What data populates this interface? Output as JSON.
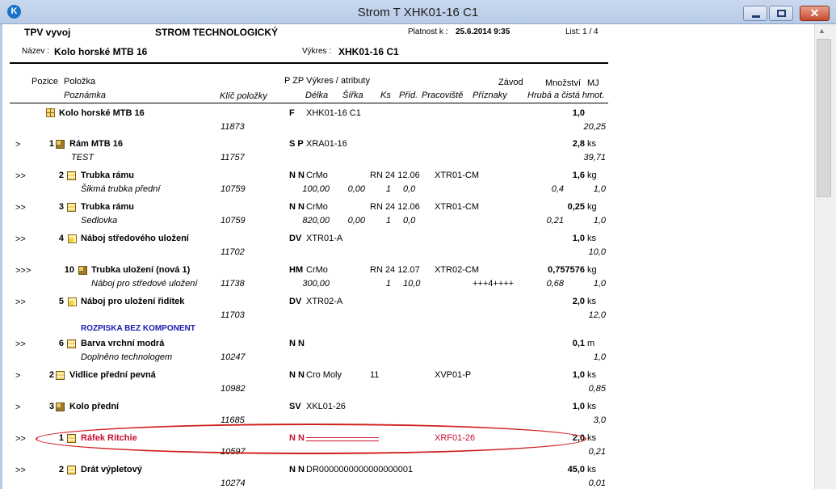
{
  "window": {
    "title": "Strom T  XHK01-16 C1"
  },
  "header": {
    "app": "TPV vyvoj",
    "report_title": "STROM TECHNOLOGICKÝ",
    "valid_label": "Platnost k :",
    "valid_value": "25.6.2014 9:35",
    "sheet": "List: 1 / 4",
    "name_label": "Název :",
    "name_value": "Kolo horské MTB 16",
    "drawing_label": "Výkres :",
    "drawing_value": "XHK01-16 C1"
  },
  "columns": {
    "pozice": "Pozice",
    "polozka": "Položka",
    "poznamka": "Poznámka",
    "klic": "Klíč položky",
    "pzp": "P ZP Výkres / atributy",
    "delka": "Délka",
    "sirka": "Šířka",
    "ks": "Ks",
    "prid": "Příd.",
    "pracoviste": "Pracoviště",
    "zavod": "Závod",
    "priznaky": "Příznaky",
    "mnozstvi": "Množství",
    "mj": "MJ",
    "hruba": "Hrubá a čistá hmot."
  },
  "rows": [
    {
      "level": "",
      "pos": "",
      "name": "Kolo horské MTB 16",
      "key": "11873",
      "pzp": "F",
      "drawing": "XHK01-16 C1",
      "qty": "1,0",
      "unit": "",
      "weight": "20,25"
    },
    {
      "level": ">",
      "pos": "1",
      "name": "Rám MTB 16",
      "note": "TEST",
      "key": "11757",
      "pzp": "S P",
      "drawing": "XRA01-16",
      "qty": "2,8",
      "unit": "ks",
      "weight": "39,71"
    },
    {
      "level": ">>",
      "pos": "2",
      "name": "Trubka rámu",
      "note": "Šikmá trubka přední",
      "key": "10759",
      "pzp": "N N",
      "drawing": "CrMo",
      "delka": "100,00",
      "sirka": "0,00",
      "ks": "1",
      "prid": "0,0",
      "rn": "RN 24 12.06",
      "prac": "XTR01-CM",
      "qty": "1,6",
      "unit": "kg",
      "gross": "0,4",
      "weight": "1,0"
    },
    {
      "level": ">>",
      "pos": "3",
      "name": "Trubka rámu",
      "note": "Sedlovka",
      "key": "10759",
      "pzp": "N N",
      "drawing": "CrMo",
      "delka": "820,00",
      "sirka": "0,00",
      "ks": "1",
      "prid": "0,0",
      "rn": "RN 24 12.06",
      "prac": "XTR01-CM",
      "qty": "0,25",
      "unit": "kg",
      "gross": "0,21",
      "weight": "1,0"
    },
    {
      "level": ">>",
      "pos": "4",
      "name": "Náboj středového uložení",
      "key": "11702",
      "pzp": "DV",
      "drawing": "XTR01-A",
      "qty": "1,0",
      "unit": "ks",
      "weight": "10,0"
    },
    {
      "level": ">>>",
      "pos": "10",
      "name": "Trubka uložení (nová 1)",
      "note": "Náboj pro středové uložení",
      "key": "11738",
      "pzp": "HM",
      "drawing": "CrMo",
      "delka": "300,00",
      "ks": "1",
      "prid": "10,0",
      "rn": "RN 24 12.07",
      "prac": "XTR02-CM",
      "priz": "+++4++++",
      "qty": "0,757576",
      "unit": "kg",
      "gross": "0,68",
      "weight": "1,0"
    },
    {
      "level": ">>",
      "pos": "5",
      "name": "Náboj pro uložení řidítek",
      "key": "11703",
      "pzp": "DV",
      "drawing": "XTR02-A",
      "qty": "2,0",
      "unit": "ks",
      "weight": "12,0"
    },
    {
      "section": "ROZPISKA BEZ KOMPONENT"
    },
    {
      "level": ">>",
      "pos": "6",
      "name": "Barva vrchní modrá",
      "note": "Doplněno technologem",
      "key": "10247",
      "pzp": "N N",
      "qty": "0,1",
      "unit": "m",
      "weight": "1,0"
    },
    {
      "level": ">",
      "pos": "2",
      "name": "Vidlice přední pevná",
      "key": "10982",
      "pzp": "N N",
      "drawing": "Cro Moly",
      "ks": "11",
      "prac": "XVP01-P",
      "qty": "1,0",
      "unit": "ks",
      "weight": "0,85"
    },
    {
      "level": ">",
      "pos": "3",
      "name": "Kolo přední",
      "key": "11685",
      "pzp": "SV",
      "drawing": "XKL01-26",
      "qty": "1,0",
      "unit": "ks",
      "weight": "3,0"
    },
    {
      "level": ">>",
      "pos": "1",
      "name": "Ráfek Ritchie",
      "key": "10597",
      "pzp": "N N",
      "prac": "XRF01-26",
      "qty": "2,0",
      "unit": "ks",
      "weight": "0,21",
      "highlight": true
    },
    {
      "level": ">>",
      "pos": "2",
      "name": "Drát výpletový",
      "key": "10274",
      "pzp": "N N",
      "drawing": "DR0000000000000000001",
      "qty": "45,0",
      "unit": "ks",
      "weight": "0,01"
    }
  ],
  "accent": {
    "highlight": "#c8102e",
    "section": "#1a1ab0"
  }
}
